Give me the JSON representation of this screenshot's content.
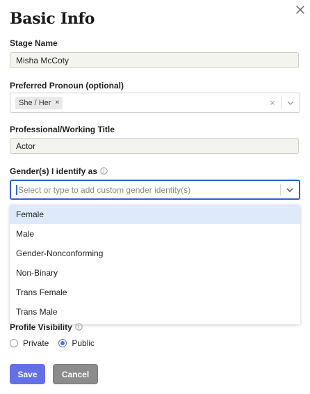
{
  "dialog": {
    "title": "Basic Info"
  },
  "stage_name": {
    "label": "Stage Name",
    "value": "Misha McCoty"
  },
  "pronoun": {
    "label": "Preferred Pronoun (optional)",
    "chip": "She / Her",
    "chip_remove": "×",
    "clear": "×"
  },
  "title_field": {
    "label": "Professional/Working Title",
    "value": "Actor"
  },
  "gender": {
    "label": "Gender(s) I identify as",
    "placeholder": "Select or type to add custom gender identity(s)",
    "options": [
      "Female",
      "Male",
      "Gender-Nonconforming",
      "Non-Binary",
      "Trans Female",
      "Trans Male"
    ],
    "highlighted": "Female"
  },
  "visibility": {
    "label": "Profile Visibility",
    "options": [
      "Private",
      "Public"
    ],
    "selected": "Public"
  },
  "actions": {
    "save": "Save",
    "cancel": "Cancel"
  },
  "colors": {
    "accent": "#6470e6",
    "focus": "#2f5fd0",
    "highlight": "#dee9fb",
    "cancel": "#8c8c8c"
  }
}
